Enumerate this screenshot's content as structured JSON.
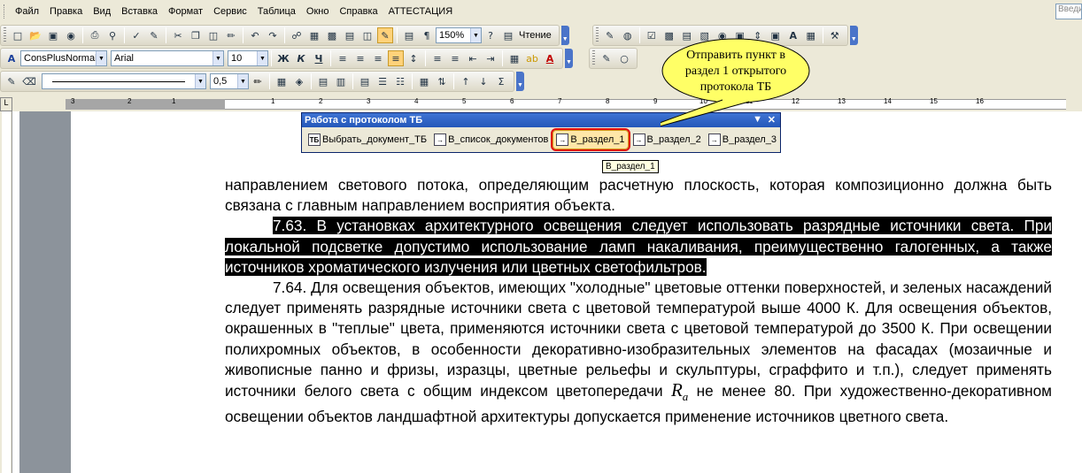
{
  "menu": {
    "items": [
      "Файл",
      "Правка",
      "Вид",
      "Вставка",
      "Формат",
      "Сервис",
      "Таблица",
      "Окно",
      "Справка",
      "АТТЕСТАЦИЯ"
    ],
    "search_placeholder": "Введи"
  },
  "toolbar_standard": {
    "zoom": "150%",
    "read_label": "Чтение"
  },
  "toolbar_format": {
    "style": "ConsPlusNormal",
    "font": "Arial",
    "size": "10",
    "bold": "Ж",
    "italic": "К",
    "underline": "Ч"
  },
  "toolbar_draw": {
    "line_width": "0,5"
  },
  "ruler": {
    "corner": "L",
    "numbers": [
      "3",
      "2",
      "1",
      "1",
      "2",
      "3",
      "4",
      "5",
      "6",
      "7",
      "8",
      "9",
      "10",
      "11",
      "12",
      "13",
      "14",
      "15",
      "16"
    ]
  },
  "floating_toolbar": {
    "title": "Работа с протоколом ТБ",
    "buttons": [
      {
        "icon": "ТБ",
        "label": "Выбрать_документ_ТБ"
      },
      {
        "icon": "",
        "label": "В_список_документов"
      },
      {
        "icon": "",
        "label": "В_раздел_1"
      },
      {
        "icon": "",
        "label": "В_раздел_2"
      },
      {
        "icon": "",
        "label": "В_раздел_3"
      }
    ]
  },
  "tooltip": "В_раздел_1",
  "callout": {
    "lines": [
      "Отправить пункт в",
      "раздел 1 открытого",
      "протокола ТБ"
    ],
    "color": "#FFFF66"
  },
  "document": {
    "p1": "направлением светового потока, определяющим расчетную плоскость, которая композиционно должна быть связана с главным направлением восприятия объекта.",
    "p2": "7.63. В установках архитектурного освещения следует использовать разрядные источники света. При локальной подсветке допустимо использование ламп накаливания, преимущественно галогенных, а также источников хроматического излучения или цветных светофильтров.",
    "p3a": "7.64. Для освещения объектов, имеющих \"холодные\" цветовые оттенки поверхностей, и зеленых насаждений следует применять разрядные источники света с цветовой температурой выше 4000 К. Для освещения объектов, окрашенных в \"теплые\" цвета, применяются источники света с цветовой температурой до 3500 К. При освещении полихромных объектов, в особенности декоративно-изобразительных элементов на фасадах (мозаичные и живописные панно и фризы, изразцы, цветные рельефы и скульптуры, сграффито и т.п.), следует применять источники белого света с общим индексом цветопередачи",
    "math_var": "R",
    "math_sub": "a",
    "p3b": "не менее 80. При художественно-декоративном освещении объектов ландшафтной архитектуры допускается применение источников цветного света."
  }
}
